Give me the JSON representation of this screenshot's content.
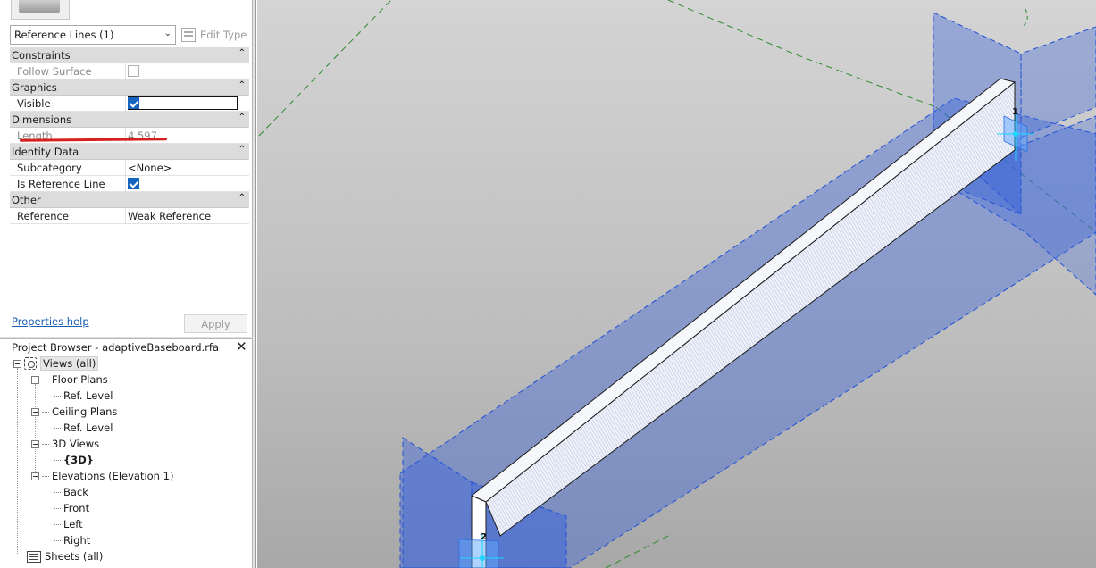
{
  "properties": {
    "type_selector": "Reference Lines (1)",
    "edit_type_label": "Edit Type",
    "groups": [
      {
        "title": "Constraints",
        "rows": [
          {
            "name": "Follow Surface",
            "kind": "checkbox",
            "checked": false,
            "disabled": true
          }
        ]
      },
      {
        "title": "Graphics",
        "rows": [
          {
            "name": "Visible",
            "kind": "checkbox",
            "checked": true,
            "disabled": false
          }
        ]
      },
      {
        "title": "Dimensions",
        "rows": [
          {
            "name": "Length",
            "kind": "text",
            "value": "4.597",
            "disabled": true
          }
        ]
      },
      {
        "title": "Identity Data",
        "rows": [
          {
            "name": "Subcategory",
            "kind": "text",
            "value": "<None>",
            "disabled": false
          },
          {
            "name": "Is Reference Line",
            "kind": "checkbox",
            "checked": true,
            "disabled": false
          }
        ]
      },
      {
        "title": "Other",
        "rows": [
          {
            "name": "Reference",
            "kind": "text",
            "value": "Weak Reference",
            "disabled": false
          }
        ]
      }
    ],
    "help_link": "Properties help",
    "apply_label": "Apply"
  },
  "project_browser": {
    "title": "Project Browser - adaptiveBaseboard.rfa",
    "root": "Views (all)",
    "floor_plans": "Floor Plans",
    "floor_ref_level": "Ref. Level",
    "ceiling_plans": "Ceiling Plans",
    "ceiling_ref_level": "Ref. Level",
    "views_3d": "3D Views",
    "view_3d": "{3D}",
    "elevations": "Elevations (Elevation 1)",
    "elev_back": "Back",
    "elev_front": "Front",
    "elev_left": "Left",
    "elev_right": "Right",
    "sheets": "Sheets (all)"
  },
  "viewport": {
    "point_labels": [
      "1",
      "2"
    ],
    "colors": {
      "plane": "#3d66d9",
      "plane_edge": "#1f4fd6",
      "ref_dash": "#2e8b2e",
      "beam_face": "#e6eaf6",
      "point": "#19d7ff"
    }
  }
}
